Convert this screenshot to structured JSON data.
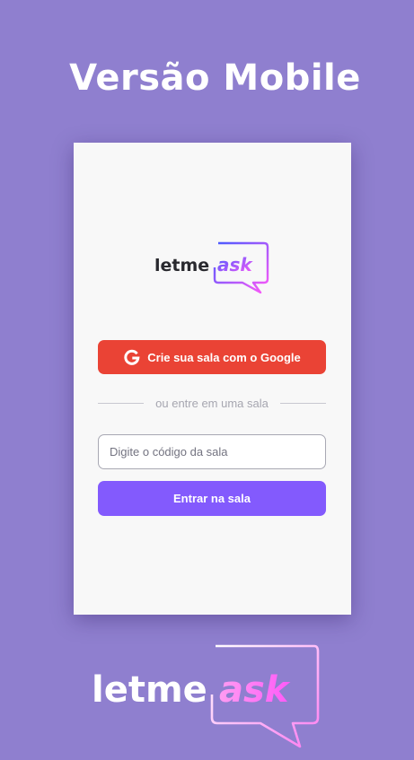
{
  "header": {
    "title": "Versão Mobile"
  },
  "logo": {
    "word_main": "letme",
    "word_accent": "ask"
  },
  "auth": {
    "google_button_label": "Crie sua sala com o Google",
    "separator_text": "ou entre em uma sala",
    "room_code_placeholder": "Digite o código da sala",
    "room_code_value": "",
    "enter_button_label": "Entrar na sala"
  },
  "colors": {
    "background": "#8f7fcf",
    "google_red": "#ea4335",
    "primary_purple": "#835afd",
    "logo_gradient_start": "#485bff",
    "logo_gradient_end": "#ff59f8"
  },
  "icons": {
    "google": "google-g-icon",
    "speech_bubble": "speech-bubble-icon"
  }
}
